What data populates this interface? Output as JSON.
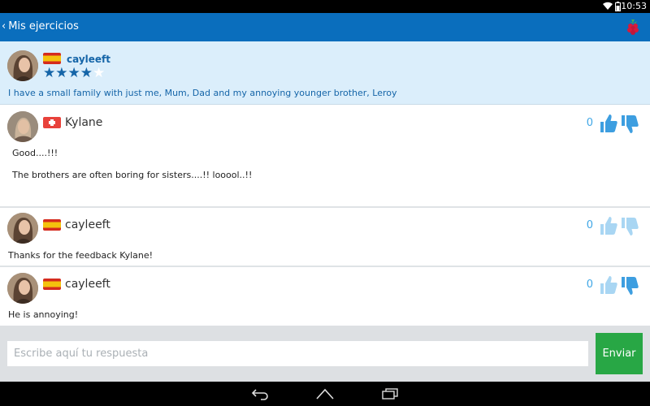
{
  "status_bar": {
    "time": "10:53",
    "icons": [
      "wifi-icon",
      "battery-icon"
    ]
  },
  "app_bar": {
    "back_label": "Mis ejercicios",
    "logo_icon": "raspberry-icon",
    "color": "#0a6ebd"
  },
  "post": {
    "username": "cayleeft",
    "flag": "spain",
    "rating": 4,
    "max_rating": 5,
    "text": "I have a small family with just me, Mum, Dad and my annoying younger brother, Leroy"
  },
  "comments": [
    {
      "username": "Kylane",
      "flag": "switzerland",
      "likes": "0",
      "body": [
        "Good....!!!",
        "The brothers are often boring for sisters....!! looool..!!"
      ]
    },
    {
      "username": "cayleeft",
      "flag": "spain",
      "likes": "0",
      "body": [
        "Thanks for the feedback Kylane!"
      ]
    },
    {
      "username": "cayleeft",
      "flag": "spain",
      "likes": "0",
      "body": [
        "He is annoying!"
      ]
    }
  ],
  "reply": {
    "placeholder": "Escribe aquí tu respuesta",
    "send_label": "Enviar",
    "send_color": "#28a745"
  },
  "nav": [
    "back-nav-icon",
    "home-nav-icon",
    "recents-nav-icon"
  ]
}
